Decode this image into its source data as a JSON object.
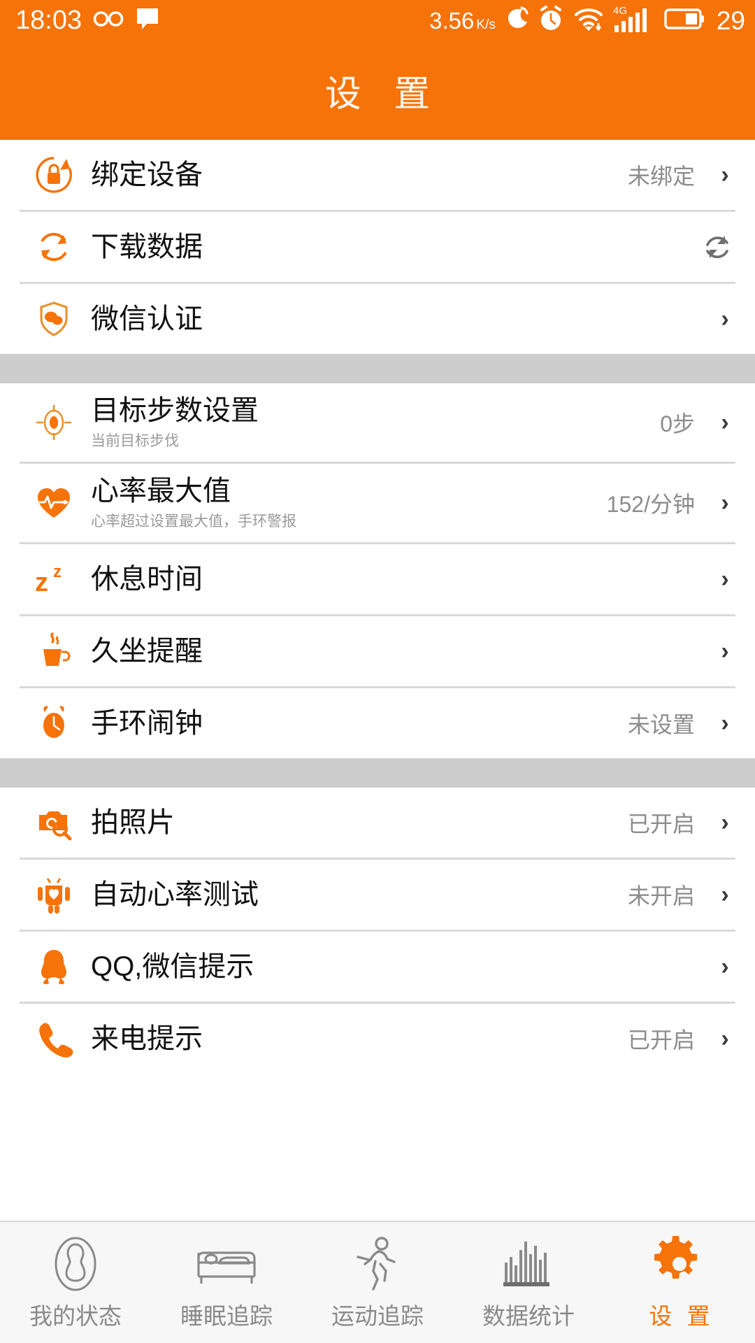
{
  "theme": {
    "orange": "#F57309",
    "gray_band": "#cdcdcd",
    "value_gray": "#8c8c8c",
    "sub_gray": "#9a9a9a"
  },
  "status_bar": {
    "time": "18:03",
    "infinity_icon": "infinity-icon",
    "message_icon": "message-bubble-icon",
    "net_speed": "3.56",
    "net_speed_unit": "K/s",
    "do_not_disturb_icon": "moon-icon",
    "alarm_icon": "alarm-clock-icon",
    "wifi_icon": "wifi-icon",
    "network_type": "4G",
    "signal_icon": "signal-bars-icon",
    "battery_icon": "battery-icon",
    "battery_level": "29"
  },
  "header": {
    "title": "设 置"
  },
  "sections": [
    {
      "rows": [
        {
          "icon": "bind-device-lock-icon",
          "title": "绑定设备",
          "sub": "",
          "value": "未绑定",
          "accessory": "chevron"
        },
        {
          "icon": "download-sync-icon",
          "title": "下载数据",
          "sub": "",
          "value": "",
          "accessory": "refresh"
        },
        {
          "icon": "wechat-shield-icon",
          "title": "微信认证",
          "sub": "",
          "value": "",
          "accessory": "chevron"
        }
      ]
    },
    {
      "rows": [
        {
          "icon": "target-steps-icon",
          "title": "目标步数设置",
          "sub": "当前目标步伐",
          "value": "0步",
          "accessory": "chevron"
        },
        {
          "icon": "heart-rate-icon",
          "title": "心率最大值",
          "sub": "心率超过设置最大值，手环警报",
          "value": "152/分钟",
          "accessory": "chevron"
        },
        {
          "icon": "sleep-zz-icon",
          "title": "休息时间",
          "sub": "",
          "value": "",
          "accessory": "chevron"
        },
        {
          "icon": "coffee-cup-icon",
          "title": "久坐提醒",
          "sub": "",
          "value": "",
          "accessory": "chevron"
        },
        {
          "icon": "band-alarm-icon",
          "title": "手环闹钟",
          "sub": "",
          "value": "未设置",
          "accessory": "chevron"
        }
      ]
    },
    {
      "rows": [
        {
          "icon": "camera-icon",
          "title": "拍照片",
          "sub": "",
          "value": "已开启",
          "accessory": "chevron"
        },
        {
          "icon": "android-robot-icon",
          "title": "自动心率测试",
          "sub": "",
          "value": "未开启",
          "accessory": "chevron"
        },
        {
          "icon": "qq-penguin-icon",
          "title": "QQ,微信提示",
          "sub": "",
          "value": "",
          "accessory": "chevron"
        },
        {
          "icon": "phone-call-icon",
          "title": "来电提示",
          "sub": "",
          "value": "已开启",
          "accessory": "chevron"
        }
      ]
    }
  ],
  "chevron_glyph": "›",
  "tabs": [
    {
      "icon": "my-status-person-icon",
      "label": "我的状态",
      "active": false
    },
    {
      "icon": "sleep-bed-icon",
      "label": "睡眠追踪",
      "active": false
    },
    {
      "icon": "running-person-icon",
      "label": "运动追踪",
      "active": false
    },
    {
      "icon": "bar-chart-icon",
      "label": "数据统计",
      "active": false
    },
    {
      "icon": "gear-icon",
      "label": "设 置",
      "active": true
    }
  ]
}
